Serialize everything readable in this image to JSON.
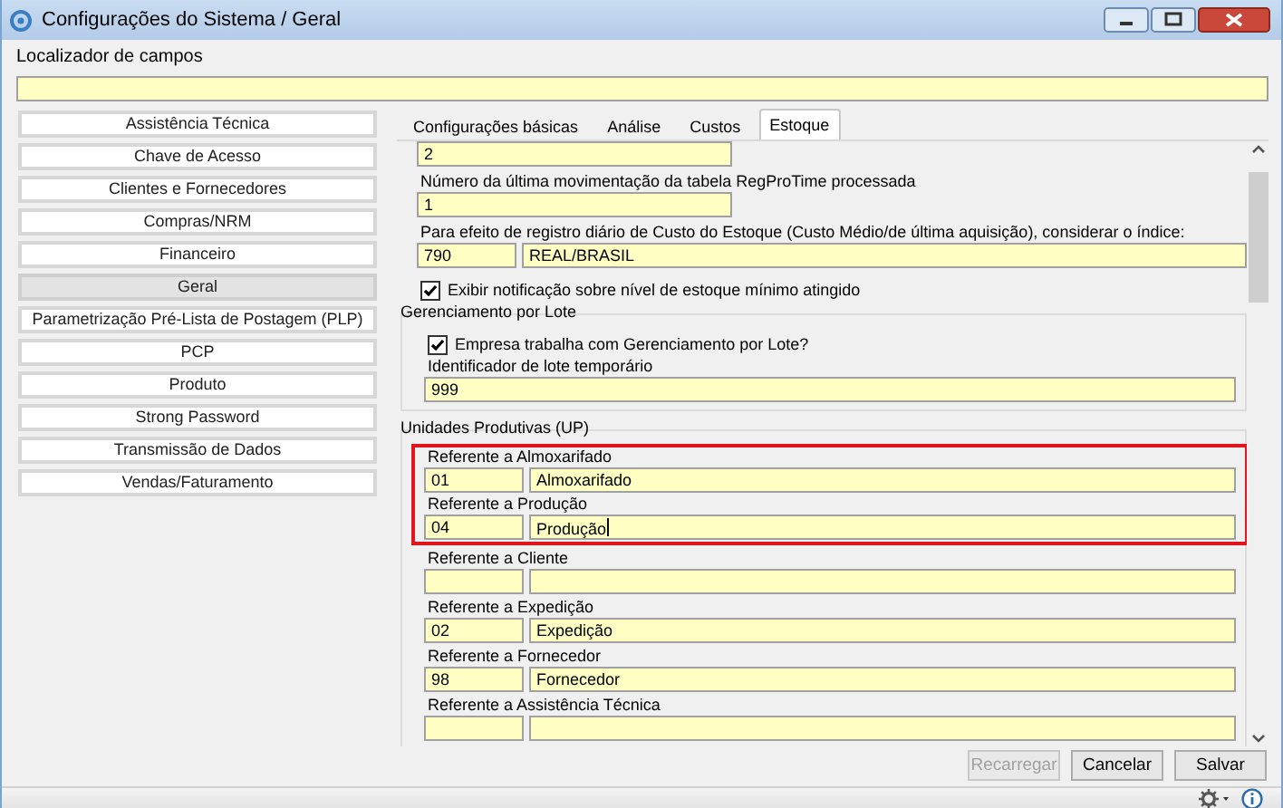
{
  "window": {
    "title": "Configurações do Sistema / Geral"
  },
  "locator": {
    "label": "Localizador de campos"
  },
  "sidebar": {
    "items": [
      {
        "label": "Assistência Técnica",
        "selected": false
      },
      {
        "label": "Chave de Acesso",
        "selected": false
      },
      {
        "label": "Clientes e Fornecedores",
        "selected": false
      },
      {
        "label": "Compras/NRM",
        "selected": false
      },
      {
        "label": "Financeiro",
        "selected": false
      },
      {
        "label": "Geral",
        "selected": true
      },
      {
        "label": "Parametrização Pré-Lista de Postagem (PLP)",
        "selected": false
      },
      {
        "label": "PCP",
        "selected": false
      },
      {
        "label": "Produto",
        "selected": false
      },
      {
        "label": "Strong Password",
        "selected": false
      },
      {
        "label": "Transmissão de Dados",
        "selected": false
      },
      {
        "label": "Vendas/Faturamento",
        "selected": false
      }
    ]
  },
  "tabs": [
    {
      "label": "Configurações básicas",
      "selected": false
    },
    {
      "label": "Análise",
      "selected": false
    },
    {
      "label": "Custos",
      "selected": false
    },
    {
      "label": "Estoque",
      "selected": true
    }
  ],
  "content": [
    {
      "kind": "field",
      "value": "2"
    },
    {
      "kind": "field",
      "label": "Número da última movimentação da tabela RegProTime processada",
      "value": "1"
    },
    {
      "kind": "pair",
      "label": "Para efeito de registro diário de Custo do Estoque (Custo Médio/de última aquisição), considerar o índice:",
      "code": "790",
      "description": "REAL/BRASIL"
    },
    {
      "kind": "checkbox",
      "label": "Exibir notificação sobre nível de estoque mínimo atingido",
      "checked": true
    },
    {
      "kind": "group",
      "title": "Gerenciamento por Lote",
      "items": [
        {
          "kind": "checkbox",
          "label": "Empresa trabalha com Gerenciamento por Lote?",
          "checked": true
        },
        {
          "kind": "field",
          "label": "Identificador de lote temporário",
          "value": "999"
        }
      ]
    },
    {
      "kind": "group",
      "title": "Unidades Produtivas (UP)",
      "items": [
        {
          "kind": "pair",
          "label": "Referente a Almoxarifado",
          "code": "01",
          "description": "Almoxarifado",
          "highlighted": true,
          "focused": false
        },
        {
          "kind": "pair",
          "label": "Referente a Produção",
          "code": "04",
          "description": "Produção",
          "highlighted": true,
          "focused": true
        },
        {
          "kind": "pair",
          "label": "Referente a Cliente",
          "highlighted": false,
          "focused": false
        },
        {
          "kind": "pair",
          "label": "Referente a Expedição",
          "code": "02",
          "description": "Expedição",
          "highlighted": false,
          "focused": false
        },
        {
          "kind": "pair",
          "label": "Referente a Fornecedor",
          "code": "98",
          "description": "Fornecedor",
          "highlighted": false,
          "focused": false
        },
        {
          "kind": "pair",
          "label": "Referente a Assistência Técnica",
          "highlighted": false,
          "focused": false
        }
      ]
    }
  ],
  "buttons": [
    {
      "label": "Recarregar",
      "disabled": true
    },
    {
      "label": "Cancelar",
      "disabled": false
    },
    {
      "label": "Salvar",
      "disabled": false
    }
  ]
}
